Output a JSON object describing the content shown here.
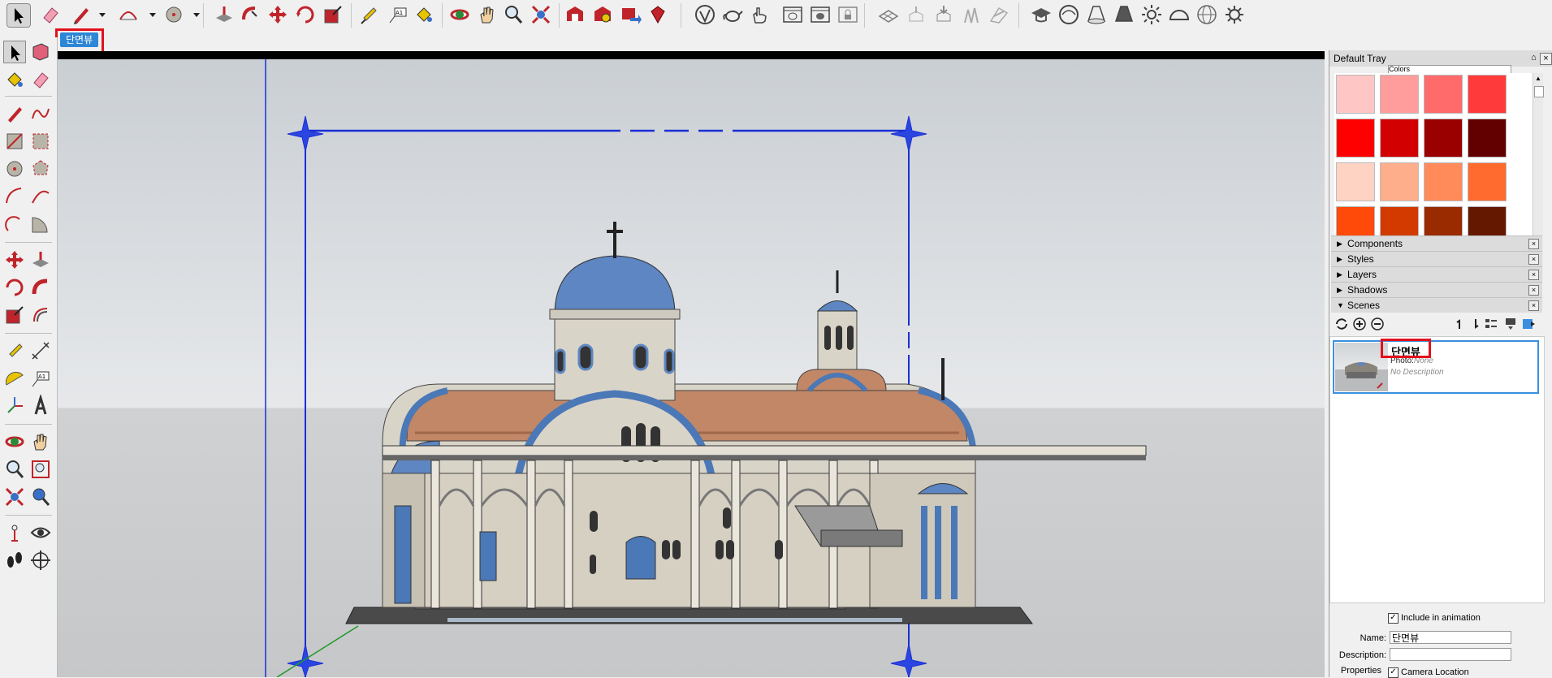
{
  "scene_tab": {
    "label": "단면뷰"
  },
  "tray": {
    "title": "Default Tray",
    "colors_combo": "Colors",
    "pin": "⌂",
    "close": "×",
    "swatches": [
      "#ffc6c6",
      "#ff9c9c",
      "#ff6a6a",
      "#ff3a3a",
      "#ff0000",
      "#d20000",
      "#9a0000",
      "#620000",
      "#ffd3c4",
      "#ffae8c",
      "#ff8a5a",
      "#ff6a2e",
      "#ff4a0a",
      "#d23a00",
      "#9a2a00",
      "#641800"
    ],
    "panels": [
      {
        "label": "Components",
        "arrow": "▶"
      },
      {
        "label": "Styles",
        "arrow": "▶"
      },
      {
        "label": "Layers",
        "arrow": "▶"
      },
      {
        "label": "Shadows",
        "arrow": "▶"
      },
      {
        "label": "Scenes",
        "arrow": "▼"
      }
    ],
    "panel_close": "×"
  },
  "scenes": {
    "item": {
      "name": "단면뷰",
      "photo_label": "Photo:",
      "photo_value": "None",
      "description": "No Description"
    },
    "include_animation": {
      "label": "Include in animation",
      "checked": "✓"
    },
    "name_label": "Name:",
    "name_value": "단면뷰",
    "description_label": "Description:",
    "description_value": "",
    "properties_label": "Properties",
    "camera_location": {
      "label": "Camera Location",
      "checked": "✓"
    }
  },
  "colors": {
    "accent": "#2e86d6",
    "highlight_box": "#e3101c",
    "section_plane": "#1a2fd6"
  }
}
